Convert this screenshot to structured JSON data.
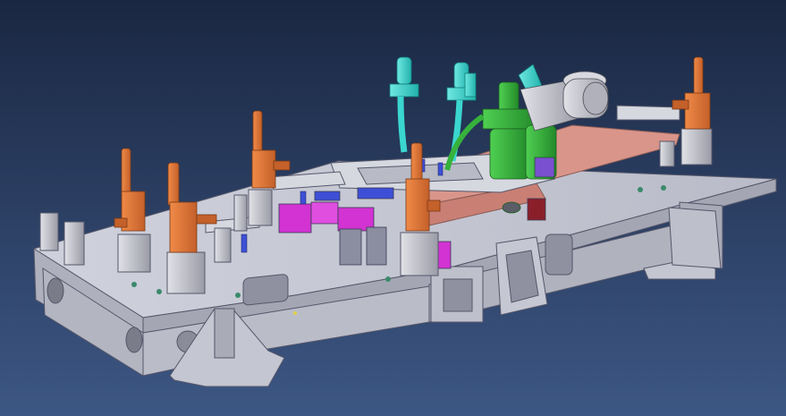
{
  "scene": {
    "background_top": "#1a2742",
    "background_bottom": "#3d5784",
    "colors": {
      "plate": "#c9cbd6",
      "plate_side": "#aeb0bd",
      "plate_edge": "#55576a",
      "clamp_orange": "#e0783a",
      "clamp_dark": "#b45a24",
      "pipe_cyan": "#3ad6cf",
      "robot_green": "#36b23c",
      "robot_grey": "#c2c3c9",
      "copper_pad": "#d9958a",
      "magenta_block": "#d233d2",
      "dark_red": "#8a1f2a",
      "blue_part": "#3d4fd6"
    },
    "icons": [
      "cad-fixture-icon"
    ]
  }
}
